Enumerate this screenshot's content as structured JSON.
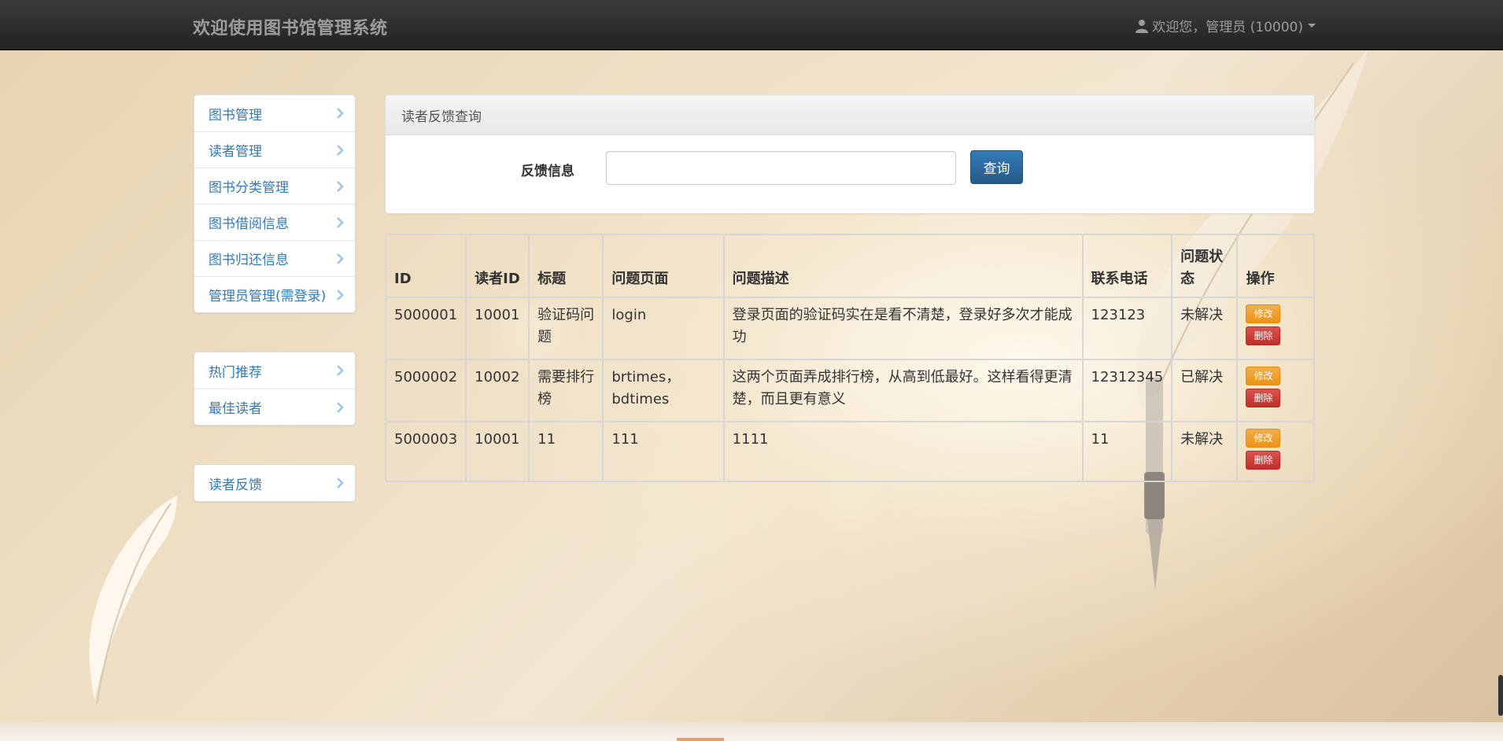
{
  "navbar": {
    "brand": "欢迎使用图书馆管理系统",
    "user_label": "欢迎您，管理员 (10000)",
    "user_icon": "user-icon"
  },
  "sidebar": {
    "group1": [
      {
        "label": "图书管理"
      },
      {
        "label": "读者管理"
      },
      {
        "label": "图书分类管理"
      },
      {
        "label": "图书借阅信息"
      },
      {
        "label": "图书归还信息"
      },
      {
        "label": "管理员管理(需登录)"
      }
    ],
    "group2": [
      {
        "label": "热门推荐"
      },
      {
        "label": "最佳读者"
      }
    ],
    "group3": [
      {
        "label": "读者反馈"
      }
    ]
  },
  "search_panel": {
    "title": "读者反馈查询",
    "field_label": "反馈信息",
    "input_value": "",
    "input_placeholder": "",
    "button_label": "查询"
  },
  "table": {
    "headers": {
      "id": "ID",
      "reader_id": "读者ID",
      "title": "标题",
      "page": "问题页面",
      "desc": "问题描述",
      "phone": "联系电话",
      "status": "问题状态",
      "ops": "操作"
    },
    "edit_label": "修改",
    "delete_label": "删除",
    "rows": [
      {
        "id": "5000001",
        "reader_id": "10001",
        "title": "验证码问题",
        "page": "login",
        "desc": "登录页面的验证码实在是看不清楚，登录好多次才能成功",
        "phone": "123123",
        "status": "未解决"
      },
      {
        "id": "5000002",
        "reader_id": "10002",
        "title": "需要排行榜",
        "page": "brtimes，bdtimes",
        "desc": "这两个页面弄成排行榜，从高到低最好。这样看得更清楚，而且更有意义",
        "phone": "12312345",
        "status": "已解决"
      },
      {
        "id": "5000003",
        "reader_id": "10001",
        "title": "11",
        "page": "111",
        "desc": "1111",
        "phone": "11",
        "status": "未解决"
      }
    ]
  },
  "colors": {
    "navbar": "#222222",
    "link": "#337ab7",
    "primary_button": "#286090",
    "warning_button": "#f0ad4e",
    "danger_button": "#d9534f"
  }
}
